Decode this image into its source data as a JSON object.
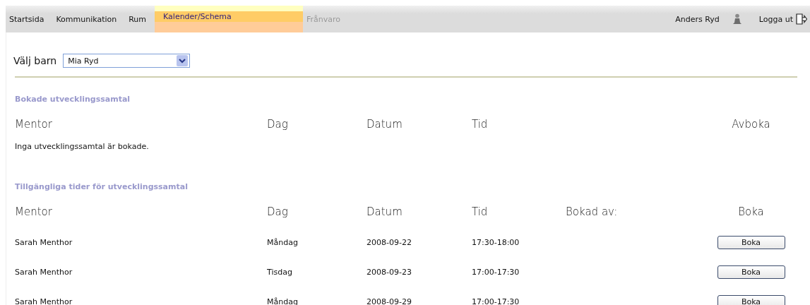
{
  "nav": {
    "tabs": [
      {
        "label": "Startsida",
        "selected": false,
        "disabled": false
      },
      {
        "label": "Kommunikation",
        "selected": false,
        "disabled": false
      },
      {
        "label": "Rum",
        "selected": false,
        "disabled": false
      },
      {
        "label": "Kalender/Schema",
        "selected": true,
        "disabled": false
      },
      {
        "label": "Frånvaro",
        "selected": false,
        "disabled": true
      }
    ],
    "user": "Anders Ryd",
    "logout": "Logga ut"
  },
  "child_select": {
    "label": "Välj barn",
    "value": "Mia Ryd"
  },
  "booked": {
    "title": "Bokade utvecklingssamtal",
    "columns": [
      "Mentor",
      "Dag",
      "Datum",
      "Tid",
      "",
      "Avboka"
    ],
    "empty_message": "Inga utvecklingssamtal är bokade."
  },
  "available": {
    "title": "Tillgängliga tider för utvecklingssamtal",
    "columns": [
      "Mentor",
      "Dag",
      "Datum",
      "Tid",
      "Bokad av:",
      "Boka"
    ],
    "rows": [
      {
        "mentor": "Sarah Menthor",
        "day": "Måndag",
        "date": "2008-09-22",
        "time": "17:30-18:00",
        "button": "Boka"
      },
      {
        "mentor": "Sarah Menthor",
        "day": "Tisdag",
        "date": "2008-09-23",
        "time": "17:00-17:30",
        "button": "Boka"
      },
      {
        "mentor": "Sarah Menthor",
        "day": "Måndag",
        "date": "2008-09-29",
        "time": "17:00-17:30",
        "button": "Boka"
      }
    ]
  }
}
